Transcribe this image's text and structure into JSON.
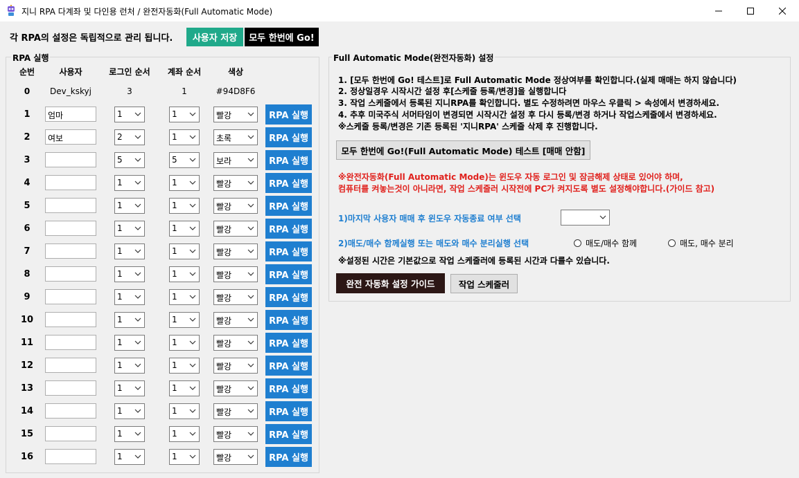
{
  "window": {
    "title": "지니 RPA 다계좌 및 다인용 런처 / 완전자동화(Full Automatic Mode)"
  },
  "top_bar": {
    "notice": "각 RPA의 설정은 독립적으로 관리 됩니다.",
    "save_label": "사용자 저장",
    "go_all_label": "모두 한번에 Go!"
  },
  "rpa_section": {
    "title": "RPA 실행",
    "headers": {
      "order": "순번",
      "user": "사용자",
      "login_order": "로그인 순서",
      "account_order": "계좌 순서",
      "color": "색상"
    },
    "summary_row": {
      "order": "0",
      "user": "Dev_kskyj",
      "login_order": "3",
      "account_order": "1",
      "color": "#94D8F6"
    },
    "run_label": "RPA 실행",
    "rows": [
      {
        "num": "1",
        "user": "엄마",
        "login": "1",
        "account": "1",
        "color": "빨강"
      },
      {
        "num": "2",
        "user": "여보",
        "login": "2",
        "account": "1",
        "color": "초록"
      },
      {
        "num": "3",
        "user": "",
        "login": "5",
        "account": "5",
        "color": "보라"
      },
      {
        "num": "4",
        "user": "",
        "login": "1",
        "account": "1",
        "color": "빨강"
      },
      {
        "num": "5",
        "user": "",
        "login": "1",
        "account": "1",
        "color": "빨강"
      },
      {
        "num": "6",
        "user": "",
        "login": "1",
        "account": "1",
        "color": "빨강"
      },
      {
        "num": "7",
        "user": "",
        "login": "1",
        "account": "1",
        "color": "빨강"
      },
      {
        "num": "8",
        "user": "",
        "login": "1",
        "account": "1",
        "color": "빨강"
      },
      {
        "num": "9",
        "user": "",
        "login": "1",
        "account": "1",
        "color": "빨강"
      },
      {
        "num": "10",
        "user": "",
        "login": "1",
        "account": "1",
        "color": "빨강"
      },
      {
        "num": "11",
        "user": "",
        "login": "1",
        "account": "1",
        "color": "빨강"
      },
      {
        "num": "12",
        "user": "",
        "login": "1",
        "account": "1",
        "color": "빨강"
      },
      {
        "num": "13",
        "user": "",
        "login": "1",
        "account": "1",
        "color": "빨강"
      },
      {
        "num": "14",
        "user": "",
        "login": "1",
        "account": "1",
        "color": "빨강"
      },
      {
        "num": "15",
        "user": "",
        "login": "1",
        "account": "1",
        "color": "빨강"
      },
      {
        "num": "16",
        "user": "",
        "login": "1",
        "account": "1",
        "color": "빨강"
      }
    ]
  },
  "auto_section": {
    "title": "Full Automatic Mode(완전자동화) 설정",
    "instructions": [
      "1. [모두 한번에 Go! 테스트]로 Full Automatic Mode 정상여부를 확인합니다.(실제 매매는 하지 않습니다)",
      "2. 정상일경우 시작시간 설정 후[스케줄 등록/변경]을 실행합니다",
      "3. 작업 스케줄에서 등록된 지니RPA를 확인합니다. 별도 수정하려면 마우스 우클릭 > 속성에서 변경하세요.",
      "4. 추후 미국주식 서머타임이 변경되면 시작시간 설정 후 다시 등록/변경 하거나 작업스케줄에서 변경하세요.",
      "※스케줄 등록/변경은 기존 등록된 '지니RPA' 스케줄 삭제 후 진행합니다."
    ],
    "test_button": "모두 한번에 Go!(Full Automatic Mode) 테스트 [매매 안함]",
    "warning_lines": [
      "※완전자동화(Full Automatic Mode)는 윈도우 자동 로그인 및 잠금해제 상태로 있어야 하며,",
      "컴퓨터를 켜놓는것이 아니라면, 작업 스케줄러 시작전에 PC가 켜지도록 별도 설정해야합니다.(가이드 참고)"
    ],
    "shutdown_label": "1)마지막 사용자 매매 후 윈도우 자동종료 여부 선택",
    "shutdown_value": "",
    "mode_label": "2)매도/매수 함께실행 또는 매도와 매수 분리실행 선택",
    "mode_options": [
      "매도/매수 함께",
      "매도, 매수 분리"
    ],
    "note": "※설정된 시간은 기본값으로 작업 스케줄러에 등록된 시간과 다를수 있습니다.",
    "guide_button": "완전 자동화 설정 가이드",
    "scheduler_button": "작업 스케줄러"
  },
  "colors": {
    "save_button": "#20a98a",
    "go_all_button": "#000000",
    "rpa_button": "#1f7fd0",
    "warning_text": "#e0211d",
    "option_text": "#1f7fd0",
    "guide_button": "#2c1715"
  }
}
